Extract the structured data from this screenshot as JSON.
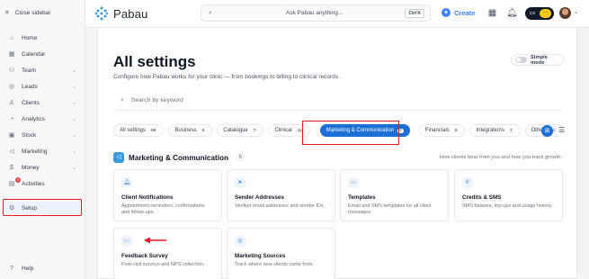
{
  "sidebar": {
    "close_label": "Close sidebar",
    "items": [
      {
        "label": "Home"
      },
      {
        "label": "Calendar"
      },
      {
        "label": "Team"
      },
      {
        "label": "Leads"
      },
      {
        "label": "Clients"
      },
      {
        "label": "Analytics"
      },
      {
        "label": "Stock"
      },
      {
        "label": "Marketing"
      },
      {
        "label": "Money"
      },
      {
        "label": "Activities",
        "badge": "1"
      },
      {
        "label": "Setup"
      },
      {
        "label": "Help"
      }
    ]
  },
  "topbar": {
    "brand": "Pabau",
    "search_placeholder": "Ask Pabau anything...",
    "shortcut": "Ctrl K",
    "create_label": "Create",
    "toggle_initials": "CS",
    "toggle_badge": "···"
  },
  "main": {
    "title": "All settings",
    "subtitle": "Configure how Pabau works for your clinic — from bookings to billing to clinical records.",
    "simple_mode_label": "Simple mode",
    "search_placeholder": "Search by keyword",
    "tabs": [
      {
        "label": "All settings",
        "count": "59"
      },
      {
        "label": "Business",
        "count": "5"
      },
      {
        "label": "Catalogue",
        "count": "7"
      },
      {
        "label": "Clinical",
        "count": "11"
      },
      {
        "label": "Marketing & Communication",
        "count": "6"
      },
      {
        "label": "Financials",
        "count": "9"
      },
      {
        "label": "Integrations",
        "count": "7"
      },
      {
        "label": "Other",
        "count": "14"
      }
    ],
    "section": {
      "title": "Marketing & Communication",
      "count": "6",
      "description": "How clients hear from you and how you track growth."
    },
    "cards": [
      {
        "title": "Client Notifications",
        "desc": "Appointment reminders, confirmations and follow-ups."
      },
      {
        "title": "Sender Addresses",
        "desc": "Verified email addresses and sender IDs."
      },
      {
        "title": "Templates",
        "desc": "Email and SMS templates for all client messages."
      },
      {
        "title": "Credits & SMS",
        "desc": "SMS balance, top-ups and usage history."
      },
      {
        "title": "Feedback Survey",
        "desc": "Post-visit surveys and NPS collection."
      },
      {
        "title": "Marketing Sources",
        "desc": "Track where new clients come from."
      }
    ]
  },
  "colors": {
    "accent": "#1d6fd8",
    "highlight": "#e11d2a"
  }
}
